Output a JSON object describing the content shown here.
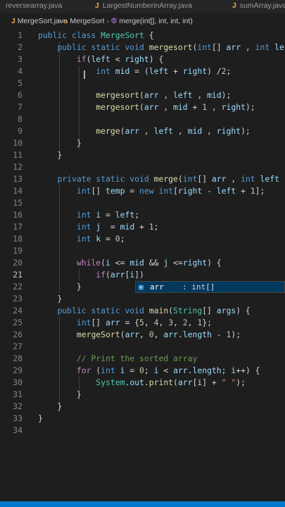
{
  "tabs": [
    {
      "name": "reversearray.java"
    },
    {
      "name": "LargestNumberinArray.java"
    },
    {
      "name": "sumArray.java"
    }
  ],
  "breadcrumb": {
    "file": "MergeSort.java",
    "class": "MergeSort",
    "method": "merge(int[], int, int, int)"
  },
  "icons": {
    "java_file_icon": "J",
    "class_icon": "‹›",
    "method_icon": "⦾",
    "field_icon": "▣"
  },
  "editor": {
    "active_line": 21,
    "line_numbers": [
      "1",
      "2",
      "3",
      "4",
      "5",
      "6",
      "7",
      "8",
      "9",
      "10",
      "11",
      "12",
      "13",
      "14",
      "15",
      "16",
      "17",
      "18",
      "19",
      "20",
      "21",
      "22",
      "23",
      "24",
      "25",
      "26",
      "27",
      "28",
      "29",
      "30",
      "31",
      "32",
      "33",
      "34"
    ]
  },
  "suggestion": {
    "name": "arr",
    "type": ": int[]"
  },
  "colors": {
    "background": "#1e1e1e",
    "keyword": "#569cd6",
    "control": "#c586c0",
    "function": "#dcdcaa",
    "type": "#4ec9b0",
    "variable": "#9cdcfe",
    "number": "#b5cea8",
    "string": "#ce9178",
    "comment": "#6a9955",
    "statusbar": "#007acc"
  }
}
